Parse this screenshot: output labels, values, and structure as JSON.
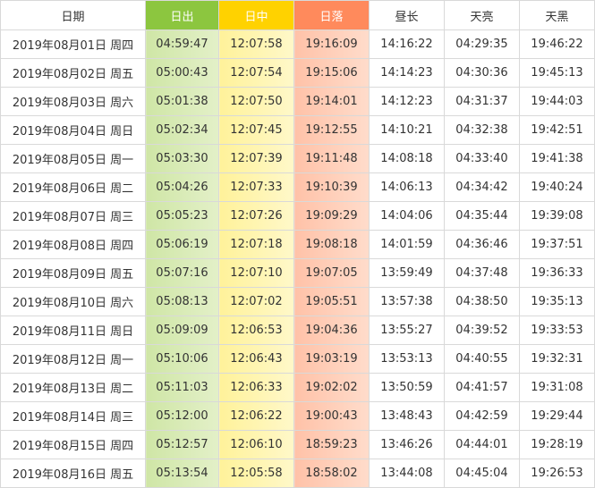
{
  "header": {
    "date": "日期",
    "sunrise": "日出",
    "noon": "日中",
    "sunset": "日落",
    "daylength": "昼长",
    "dawn": "天亮",
    "dusk": "天黑"
  },
  "colors": {
    "sunrise": "#8cc63f",
    "noon": "#ffd200",
    "sunset": "#ff8a5c"
  },
  "rows": [
    {
      "date": "2019年08月01日 周四",
      "sunrise": "04:59:47",
      "noon": "12:07:58",
      "sunset": "19:16:09",
      "daylength": "14:16:22",
      "dawn": "04:29:35",
      "dusk": "19:46:22"
    },
    {
      "date": "2019年08月02日 周五",
      "sunrise": "05:00:43",
      "noon": "12:07:54",
      "sunset": "19:15:06",
      "daylength": "14:14:23",
      "dawn": "04:30:36",
      "dusk": "19:45:13"
    },
    {
      "date": "2019年08月03日 周六",
      "sunrise": "05:01:38",
      "noon": "12:07:50",
      "sunset": "19:14:01",
      "daylength": "14:12:23",
      "dawn": "04:31:37",
      "dusk": "19:44:03"
    },
    {
      "date": "2019年08月04日 周日",
      "sunrise": "05:02:34",
      "noon": "12:07:45",
      "sunset": "19:12:55",
      "daylength": "14:10:21",
      "dawn": "04:32:38",
      "dusk": "19:42:51"
    },
    {
      "date": "2019年08月05日 周一",
      "sunrise": "05:03:30",
      "noon": "12:07:39",
      "sunset": "19:11:48",
      "daylength": "14:08:18",
      "dawn": "04:33:40",
      "dusk": "19:41:38"
    },
    {
      "date": "2019年08月06日 周二",
      "sunrise": "05:04:26",
      "noon": "12:07:33",
      "sunset": "19:10:39",
      "daylength": "14:06:13",
      "dawn": "04:34:42",
      "dusk": "19:40:24"
    },
    {
      "date": "2019年08月07日 周三",
      "sunrise": "05:05:23",
      "noon": "12:07:26",
      "sunset": "19:09:29",
      "daylength": "14:04:06",
      "dawn": "04:35:44",
      "dusk": "19:39:08"
    },
    {
      "date": "2019年08月08日 周四",
      "sunrise": "05:06:19",
      "noon": "12:07:18",
      "sunset": "19:08:18",
      "daylength": "14:01:59",
      "dawn": "04:36:46",
      "dusk": "19:37:51"
    },
    {
      "date": "2019年08月09日 周五",
      "sunrise": "05:07:16",
      "noon": "12:07:10",
      "sunset": "19:07:05",
      "daylength": "13:59:49",
      "dawn": "04:37:48",
      "dusk": "19:36:33"
    },
    {
      "date": "2019年08月10日 周六",
      "sunrise": "05:08:13",
      "noon": "12:07:02",
      "sunset": "19:05:51",
      "daylength": "13:57:38",
      "dawn": "04:38:50",
      "dusk": "19:35:13"
    },
    {
      "date": "2019年08月11日 周日",
      "sunrise": "05:09:09",
      "noon": "12:06:53",
      "sunset": "19:04:36",
      "daylength": "13:55:27",
      "dawn": "04:39:52",
      "dusk": "19:33:53"
    },
    {
      "date": "2019年08月12日 周一",
      "sunrise": "05:10:06",
      "noon": "12:06:43",
      "sunset": "19:03:19",
      "daylength": "13:53:13",
      "dawn": "04:40:55",
      "dusk": "19:32:31"
    },
    {
      "date": "2019年08月13日 周二",
      "sunrise": "05:11:03",
      "noon": "12:06:33",
      "sunset": "19:02:02",
      "daylength": "13:50:59",
      "dawn": "04:41:57",
      "dusk": "19:31:08"
    },
    {
      "date": "2019年08月14日 周三",
      "sunrise": "05:12:00",
      "noon": "12:06:22",
      "sunset": "19:00:43",
      "daylength": "13:48:43",
      "dawn": "04:42:59",
      "dusk": "19:29:44"
    },
    {
      "date": "2019年08月15日 周四",
      "sunrise": "05:12:57",
      "noon": "12:06:10",
      "sunset": "18:59:23",
      "daylength": "13:46:26",
      "dawn": "04:44:01",
      "dusk": "19:28:19"
    },
    {
      "date": "2019年08月16日 周五",
      "sunrise": "05:13:54",
      "noon": "12:05:58",
      "sunset": "18:58:02",
      "daylength": "13:44:08",
      "dawn": "04:45:04",
      "dusk": "19:26:53"
    }
  ]
}
